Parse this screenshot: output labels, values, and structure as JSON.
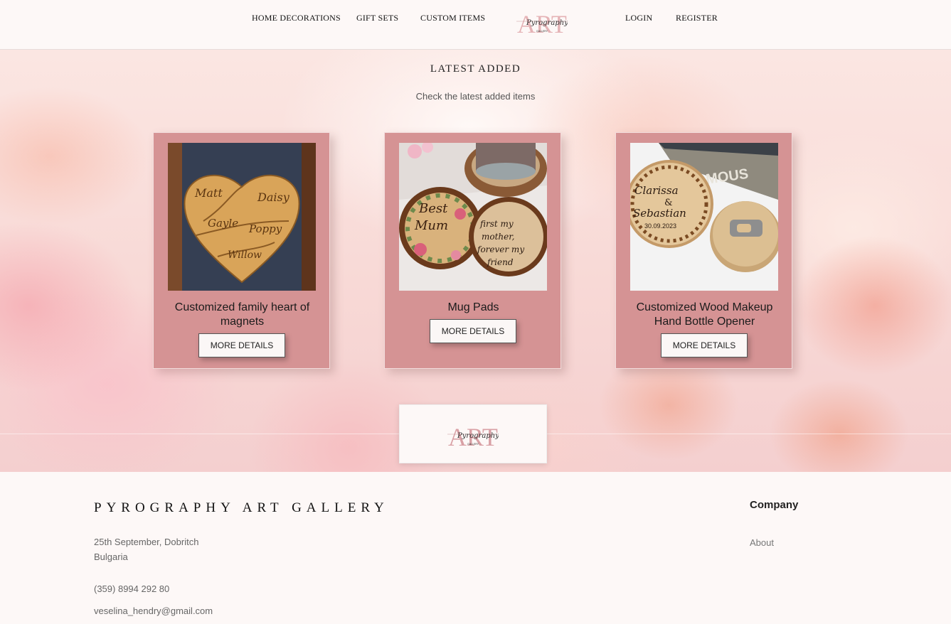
{
  "nav": {
    "home_decorations": "HOME DECORATIONS",
    "gift_sets": "GIFT SETS",
    "custom_items": "CUSTOM ITEMS",
    "login": "LOGIN",
    "register": "REGISTER"
  },
  "logo": {
    "big_letters": "ART",
    "script_text": "Pyrography",
    "small_text": "GALLERY"
  },
  "section": {
    "title": "LATEST ADDED",
    "subtitle": "Check the latest added items"
  },
  "products": [
    {
      "title": "Customized family heart of magnets",
      "button": "MORE DETAILS",
      "image_names": [
        "Matt",
        "Daisy",
        "Gayle",
        "Poppy",
        "Willow"
      ]
    },
    {
      "title": "Mug Pads",
      "button": "MORE DETAILS",
      "image_text_left": [
        "Best",
        "Mum"
      ],
      "image_text_right": [
        "first my",
        "mother,",
        "forever my",
        "friend"
      ]
    },
    {
      "title": "Customized Wood Makeup Hand Bottle Opener",
      "button": "MORE DETAILS",
      "image_text": [
        "Clarissa",
        "&",
        "Sebastian",
        "30.09.2023"
      ],
      "book_text": "AMOUS"
    }
  ],
  "footer": {
    "brand": "PYROGRAPHY ART GALLERY",
    "address_line1": "25th September, Dobritch",
    "address_line2": "Bulgaria",
    "phone": "(359) 8994 292 80",
    "email": "veselina_hendry@gmail.com",
    "company_heading": "Company",
    "about_link": "About"
  },
  "colors": {
    "card_background": "#d59394",
    "page_background": "#fdf8f7",
    "logo_pink": "#d99aa0"
  }
}
